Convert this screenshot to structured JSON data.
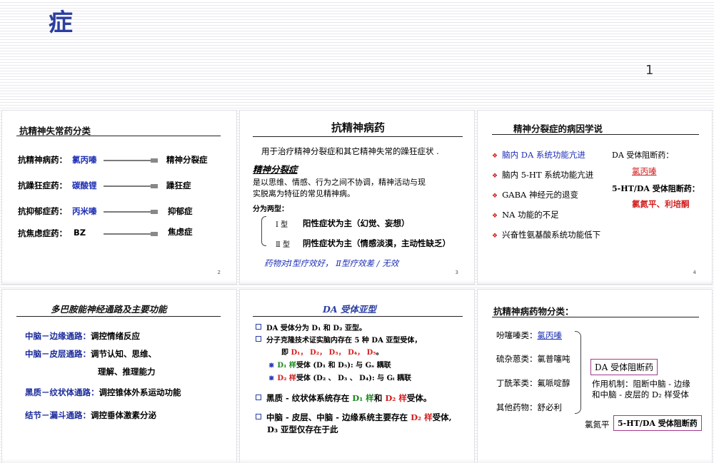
{
  "header": {
    "title_char": "症",
    "page_number": "1"
  },
  "slide1": {
    "title": "抗精神失常药分类",
    "rows": [
      {
        "label": "抗精神病药：",
        "drug": "氯丙嗪",
        "target": "精神分裂症"
      },
      {
        "label": "抗躁狂症药：",
        "drug": "碳酸锂",
        "target": "躁狂症"
      },
      {
        "label": "抗抑郁症药：",
        "drug": "丙米嗪",
        "target": "抑郁症"
      },
      {
        "label": "抗焦虑症药：",
        "drug": "BZ",
        "target": "焦虑症"
      }
    ],
    "num": "2"
  },
  "slide2": {
    "title": "抗精神病药",
    "intro": "用于治疗精神分裂症和其它精神失常的躁狂症状 .",
    "subtitle": "精神分裂症",
    "desc1": "是以思维、情感、行为之间不协调，精神活动与现",
    "desc2": "实脱离为特征的常见精神病。",
    "types_label": "分为两型：",
    "type1": "Ⅰ 型",
    "type1_desc": "阳性症状为主（幻觉、妄想）",
    "type2": "Ⅱ 型",
    "type2_desc": "阴性症状为主（情感淡漠，主动性缺乏）",
    "note": "药物对Ⅰ型疗效好，  Ⅱ型疗效差 / 无效",
    "num": "3"
  },
  "slide3": {
    "title": "精神分裂症的病因学说",
    "items": [
      "脑内 DA 系统功能亢进",
      "脑内 5-HT 系统功能亢进",
      "GABA 神经元的退变",
      "NA 功能的不足",
      "兴奋性氨基酸系统功能低下"
    ],
    "side1": "DA 受体阻断药：",
    "side1_drug": "氯丙嗪",
    "side2": "5-HT/DA 受体阻断药：",
    "side2_drug": "氯氮平、利培酮",
    "num": "4"
  },
  "slide4": {
    "title": "多巴胺能神经通路及主要功能",
    "rows": [
      {
        "path": "中脑－边缘通路：",
        "func": "调控情绪反应"
      },
      {
        "path": "中脑－皮层通路：",
        "func": "调节认知、思维、"
      },
      {
        "path": "",
        "func": "理解、推理能力"
      },
      {
        "path": "黑质－纹状体通路：",
        "func": "调控锥体外系运动功能"
      },
      {
        "path": "结节－漏斗通路：",
        "func": "调控垂体激素分泌"
      }
    ]
  },
  "slide5": {
    "title": "DA 受体亚型",
    "b1": "DA 受体分为 D₁ 和 D₂ 亚型。",
    "b2": "分子克隆技术证实脑内存在 5 种 DA 亚型受体，",
    "b2_line2_pre": "即",
    "b2_subtypes": "D₁， D₂， D₃， D₄， D₅",
    "b2_line2_post": "。",
    "x1_pre": "D₁ 样",
    "x1_post": "受体 (D₁ 和 D₅): 与 Gₛ 耦联",
    "x2_pre": "D₂ 样",
    "x2_post": "受体 (D₂ 、 D₃ 、 D₄): 与 Gᵢ 耦联",
    "b3_pre": "黑质 - 纹状体系统存在",
    "b3_d1": "D₁ 样",
    "b3_mid": "和",
    "b3_d2": "D₂ 样",
    "b3_post": "受体。",
    "b4_pre": "中脑 - 皮层、中脑 - 边缘系统主要存在",
    "b4_d2": "D₂ 样",
    "b4_post": "受体,",
    "b4_line2": "D₃ 亚型仅存在于此"
  },
  "slide6": {
    "title": "抗精神病药物分类：",
    "classes": [
      {
        "label": "吩噻嗪类：",
        "drug": "氯丙嗪"
      },
      {
        "label": "硫杂蒽类：",
        "drug": "氯普噻吨"
      },
      {
        "label": "丁酰苯类：",
        "drug": "氟哌啶醇"
      },
      {
        "label": "其他药物：",
        "drug": "舒必利"
      }
    ],
    "box1": "DA 受体阻断药",
    "mech1": "作用机制：阻断中脑 - 边缘",
    "mech2": "和中脑 - 皮层的 D₂ 样受体",
    "bottom_drug": "氯氮平",
    "box2": "5-HT/DA 受体阻断药"
  }
}
